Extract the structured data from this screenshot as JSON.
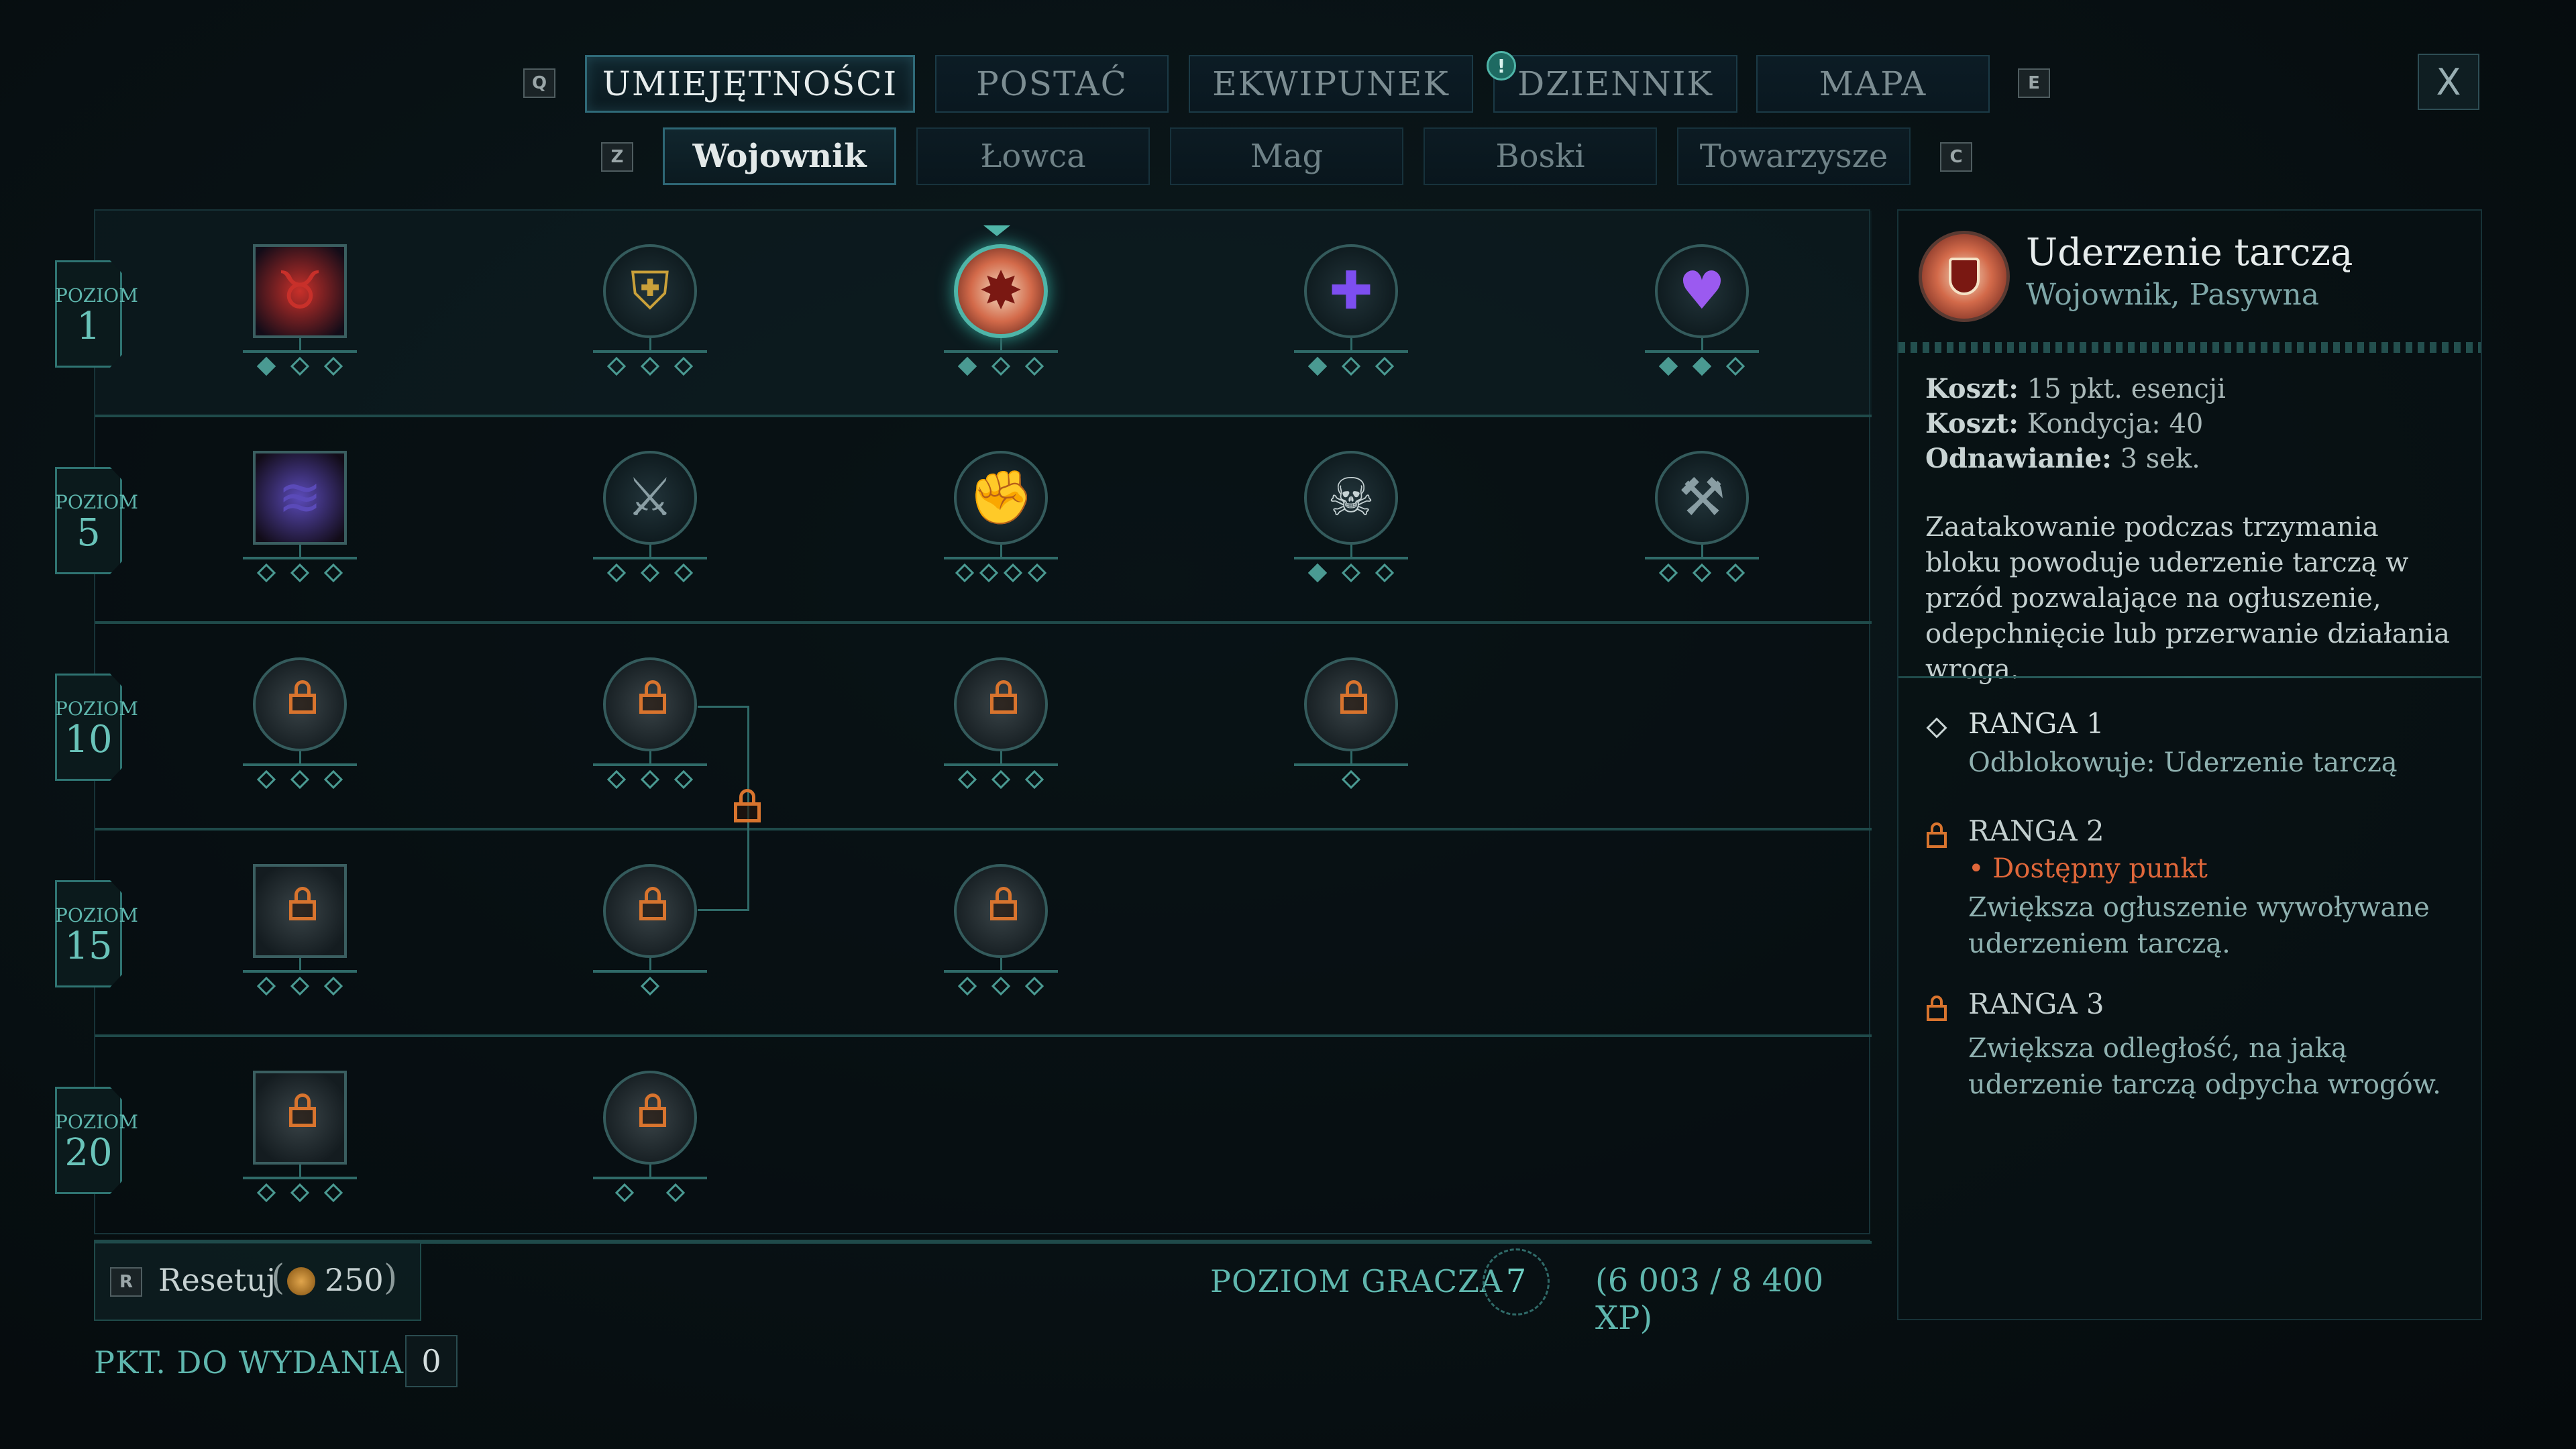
{
  "top_tabs": {
    "left_key": "Q",
    "right_key": "E",
    "items": [
      "UMIEJĘTNOŚCI",
      "POSTAĆ",
      "EKWIPUNEK",
      "DZIENNIK",
      "MAPA"
    ],
    "active_index": 0,
    "notification_badge": "!"
  },
  "close_label": "X",
  "sub_tabs": {
    "left_key": "Z",
    "right_key": "C",
    "items": [
      "Wojownik",
      "Łowca",
      "Mag",
      "Boski",
      "Towarzysze"
    ],
    "active_index": 0
  },
  "skill_tree": {
    "level_prefix": "POZIOM",
    "rows": [
      {
        "level": "1",
        "nodes": [
          {
            "icon": "bull-skull-icon",
            "shape": "square",
            "color": "#c8302a",
            "ranks": 3,
            "filled": 1,
            "locked": false
          },
          {
            "icon": "shield-glow-icon",
            "shape": "round",
            "color": "#c9a03a",
            "ranks": 3,
            "filled": 0,
            "locked": false
          },
          {
            "icon": "shield-bash-icon",
            "shape": "round",
            "color": "#e0523a",
            "ranks": 3,
            "filled": 1,
            "locked": false,
            "selected": true
          },
          {
            "icon": "cross-heal-icon",
            "shape": "round",
            "color": "#7d4ef0",
            "ranks": 3,
            "filled": 1,
            "locked": false
          },
          {
            "icon": "heart-icon",
            "shape": "round",
            "color": "#9b5af0",
            "ranks": 3,
            "filled": 2,
            "locked": false
          }
        ]
      },
      {
        "level": "5",
        "nodes": [
          {
            "icon": "claw-slash-icon",
            "shape": "square",
            "color": "#5a4ab8",
            "ranks": 3,
            "filled": 0,
            "locked": false
          },
          {
            "icon": "axe-slash-icon",
            "shape": "round",
            "color": "#8a9ea4",
            "ranks": 3,
            "filled": 0,
            "locked": false
          },
          {
            "icon": "fist-icon",
            "shape": "round",
            "color": "#8a9ea4",
            "ranks": 4,
            "filled": 0,
            "locked": false
          },
          {
            "icon": "skull-sword-icon",
            "shape": "round",
            "color": "#c6d2d4",
            "ranks": 3,
            "filled": 1,
            "locked": false
          },
          {
            "icon": "double-axe-icon",
            "shape": "round",
            "color": "#8a9ea4",
            "ranks": 3,
            "filled": 0,
            "locked": false
          }
        ]
      },
      {
        "level": "10",
        "nodes": [
          {
            "icon": "whirl-lock-icon",
            "shape": "round",
            "ranks": 3,
            "filled": 0,
            "locked": true
          },
          {
            "icon": "shield-lock-icon",
            "shape": "round",
            "ranks": 3,
            "filled": 0,
            "locked": true
          },
          {
            "icon": "spin-lock-icon",
            "shape": "round",
            "ranks": 3,
            "filled": 0,
            "locked": true
          },
          {
            "icon": "target-lock-icon",
            "shape": "round",
            "ranks": 1,
            "filled": 0,
            "locked": true
          }
        ]
      },
      {
        "level": "15",
        "nodes": [
          {
            "icon": "dash-lock-icon",
            "shape": "square",
            "ranks": 3,
            "filled": 0,
            "locked": true
          },
          {
            "icon": "vortex-lock-icon",
            "shape": "round",
            "ranks": 1,
            "filled": 0,
            "locked": true
          },
          {
            "icon": "charge-lock-icon",
            "shape": "round",
            "ranks": 3,
            "filled": 0,
            "locked": true
          }
        ]
      },
      {
        "level": "20",
        "nodes": [
          {
            "icon": "storm-lock-icon",
            "shape": "square",
            "ranks": 3,
            "filled": 0,
            "locked": true
          },
          {
            "icon": "spiral-lock-icon",
            "shape": "round",
            "ranks": 2,
            "filled": 0,
            "locked": true
          }
        ]
      }
    ]
  },
  "bottom": {
    "reset_key": "R",
    "reset_label": "Resetuj",
    "reset_cost": "250",
    "player_level_label": "POZIOM GRACZA",
    "player_level": "7",
    "xp_text": "(6 003 / 8 400 XP)",
    "points_label": "PKT. DO WYDANIA",
    "points_value": "0"
  },
  "detail": {
    "title": "Uderzenie tarczą",
    "subtitle": "Wojownik, Pasywna",
    "stats": [
      {
        "label": "Koszt:",
        "value": "15 pkt. esencji"
      },
      {
        "label": "Koszt:",
        "value": "Kondycja: 40"
      },
      {
        "label": "Odnawianie:",
        "value": "3 sek."
      }
    ],
    "description": "Zaatakowanie podczas trzymania bloku powoduje uderzenie tarczą w przód pozwalające na ogłuszenie, odepchnięcie lub przerwanie działania wroga.",
    "ranks": [
      {
        "title": "RANGA 1",
        "status": "",
        "text": "Odblokowuje: Uderzenie tarczą",
        "locked": false
      },
      {
        "title": "RANGA 2",
        "status": "• Dostępny punkt",
        "text": "Zwiększa ogłuszenie wywoływane uderzeniem tarczą.",
        "locked": true
      },
      {
        "title": "RANGA 3",
        "status": "",
        "text": "Zwiększa odległość, na jaką uderzenie tarczą odpycha wrogów.",
        "locked": true
      }
    ]
  },
  "colors": {
    "accent": "#4fb5a8",
    "lock": "#d8742e",
    "available": "#e0673a"
  }
}
